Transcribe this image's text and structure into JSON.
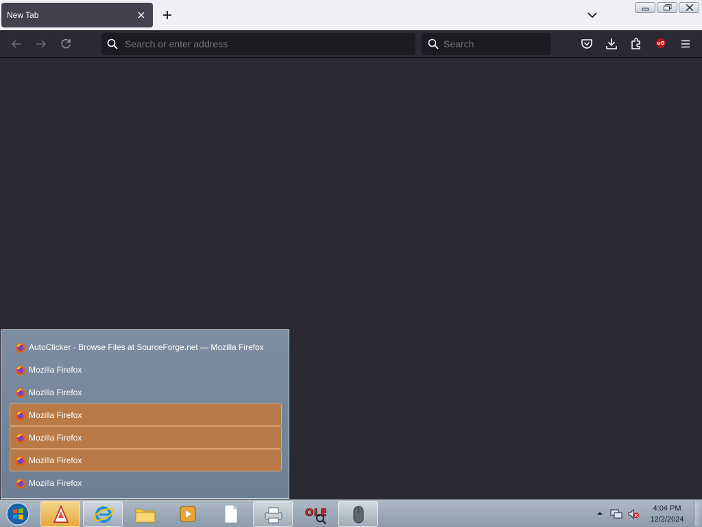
{
  "browser": {
    "tab_title": "New Tab",
    "urlbar_placeholder": "Search or enter address",
    "searchbar_placeholder": "Search",
    "ublock_badge": "uO"
  },
  "window_list": {
    "items": [
      {
        "label": "AutoClicker - Browse Files at SourceForge.net — Mozilla Firefox",
        "highlighted": false
      },
      {
        "label": "Mozilla Firefox",
        "highlighted": false
      },
      {
        "label": "Mozilla Firefox",
        "highlighted": false
      },
      {
        "label": "Mozilla Firefox",
        "highlighted": true
      },
      {
        "label": "Mozilla Firefox",
        "highlighted": true
      },
      {
        "label": "Mozilla Firefox",
        "highlighted": true
      },
      {
        "label": "Mozilla Firefox",
        "highlighted": false
      }
    ]
  },
  "taskbar": {
    "apps": [
      {
        "name": "firefox",
        "icon": "firefox-icon",
        "state": "active"
      },
      {
        "name": "internet-explorer",
        "icon": "internet-explorer-icon",
        "state": "open"
      },
      {
        "name": "file-explorer",
        "icon": "folder-icon",
        "state": "none"
      },
      {
        "name": "media-player",
        "icon": "media-player-icon",
        "state": "none"
      },
      {
        "name": "notepad",
        "icon": "document-icon",
        "state": "none"
      },
      {
        "name": "printer-tool",
        "icon": "printer-icon",
        "state": "open"
      },
      {
        "name": "ole-tool",
        "icon": "ole-icon",
        "state": "none"
      },
      {
        "name": "auto-clicker",
        "icon": "mouse-icon",
        "state": "open"
      }
    ],
    "clock_time": "4:04 PM",
    "clock_date": "12/2/2024"
  },
  "colors": {
    "browser_bg": "#2b2a33",
    "urlbar_bg": "#1c1b22",
    "highlight": "#b87a47",
    "ublock_red": "#b5141a"
  }
}
